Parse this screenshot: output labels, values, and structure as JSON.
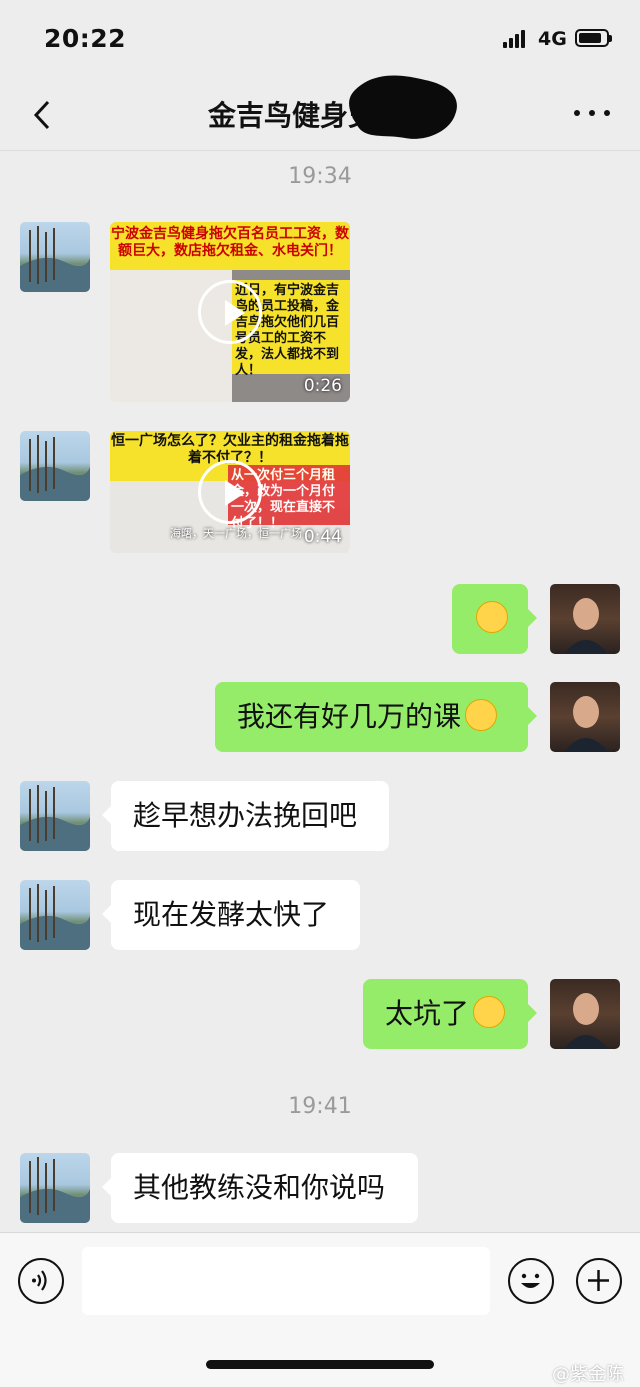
{
  "status": {
    "time": "20:22",
    "network": "4G",
    "battery_level": 0.85
  },
  "nav": {
    "title": "金吉鸟健身史家金"
  },
  "timestamps": [
    "19:34",
    "19:41"
  ],
  "videos": [
    {
      "banner": "宁波金吉鸟健身拖欠百名员工工资，数额巨大，数店拖欠租金、水电关门！",
      "overlay": "近日，有宁波金吉鸟的员工投稿，金吉鸟拖欠他们几百号员工的工资不发，法人都找不到人！",
      "duration": "0:26"
    },
    {
      "banner": "恒一广场怎么了？欠业主的租金拖着拖着不付了？！",
      "overlay": "从一次付三个月租金，改为一个月付一次，现在直接不付了！！",
      "caption": "海曙，天一广场，恒一广场",
      "duration": "0:44"
    }
  ],
  "messages": [
    {
      "side": "out",
      "text": "",
      "emoji": "worried-face"
    },
    {
      "side": "out",
      "text": "我还有好几万的课",
      "emoji": "crying-face"
    },
    {
      "side": "in",
      "text": "趁早想办法挽回吧"
    },
    {
      "side": "in",
      "text": "现在发酵太快了"
    },
    {
      "side": "out",
      "text": "太坑了",
      "emoji": "worried-face"
    },
    {
      "side": "in",
      "text": "其他教练没和你说吗"
    }
  ],
  "input": {
    "placeholder": ""
  },
  "watermark": "@紫金陈",
  "colors": {
    "bubble_out": "#95ec69",
    "bubble_in": "#ffffff",
    "background": "#ededed"
  }
}
